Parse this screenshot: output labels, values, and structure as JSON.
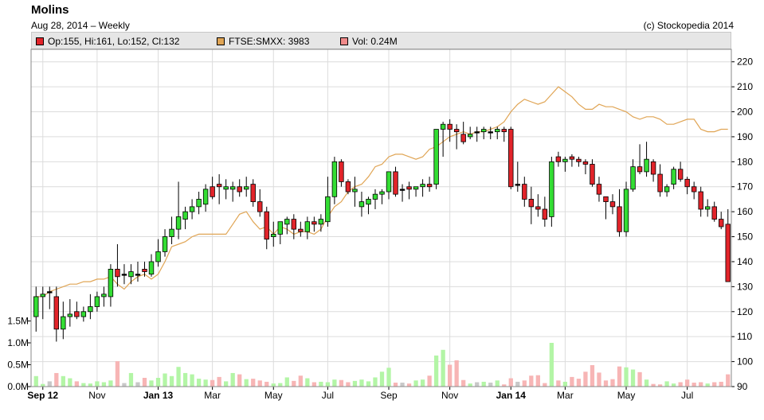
{
  "header": {
    "title": "Molins",
    "subtitle": "Aug 28, 2014  – Weekly",
    "copyright": "(c) Stockopedia 2014"
  },
  "legend": [
    {
      "label": "Op:155, Hi:161, Lo:152, Cl:132",
      "color": "#e2242a"
    },
    {
      "label": "FTSE:SMXX: 3983",
      "color": "#e0a555"
    },
    {
      "label": "Vol: 0.24M",
      "color": "#f08a8a"
    }
  ],
  "chart_data": {
    "type": "candlestick",
    "title": "Molins",
    "y_price_ticks": [
      90,
      100,
      110,
      120,
      130,
      140,
      150,
      160,
      170,
      180,
      190,
      200,
      210,
      220
    ],
    "y_price_range": [
      90,
      225
    ],
    "y_volume_ticks": [
      "0.0M",
      "0.5M",
      "1.0M",
      "1.5M"
    ],
    "y_volume_values": [
      0,
      0.5,
      1.0,
      1.5
    ],
    "x_tick_labels": [
      {
        "label": "Sep 12",
        "bold": true,
        "week": 1
      },
      {
        "label": "Nov",
        "bold": false,
        "week": 9
      },
      {
        "label": "Jan 13",
        "bold": true,
        "week": 18
      },
      {
        "label": "Mar",
        "bold": false,
        "week": 26
      },
      {
        "label": "May",
        "bold": false,
        "week": 35
      },
      {
        "label": "Jul",
        "bold": false,
        "week": 43
      },
      {
        "label": "Sep",
        "bold": false,
        "week": 52
      },
      {
        "label": "Nov",
        "bold": false,
        "week": 61
      },
      {
        "label": "Jan 14",
        "bold": true,
        "week": 70
      },
      {
        "label": "Mar",
        "bold": false,
        "week": 78
      },
      {
        "label": "May",
        "bold": false,
        "week": 87
      },
      {
        "label": "Jul",
        "bold": false,
        "week": 96
      }
    ],
    "candles": [
      [
        118,
        130,
        112,
        126
      ],
      [
        126,
        130,
        117,
        127
      ],
      [
        128,
        130,
        121,
        128
      ],
      [
        126,
        130,
        108,
        113
      ],
      [
        113,
        124,
        109,
        118
      ],
      [
        118,
        125,
        114,
        119
      ],
      [
        120,
        124,
        117,
        118
      ],
      [
        118,
        122,
        116,
        120
      ],
      [
        120,
        127,
        117,
        122
      ],
      [
        122,
        128,
        120,
        126
      ],
      [
        126,
        130,
        122,
        127
      ],
      [
        126,
        139,
        122,
        137
      ],
      [
        137,
        147,
        130,
        134
      ],
      [
        135,
        139,
        131,
        135
      ],
      [
        134,
        139,
        131,
        136
      ],
      [
        135,
        140,
        132,
        135
      ],
      [
        137,
        140,
        134,
        136
      ],
      [
        135,
        143,
        134,
        140
      ],
      [
        140,
        149,
        138,
        144
      ],
      [
        144,
        153,
        142,
        150
      ],
      [
        150,
        158,
        147,
        153
      ],
      [
        153,
        172,
        149,
        158
      ],
      [
        157,
        162,
        153,
        160
      ],
      [
        160,
        165,
        157,
        162
      ],
      [
        162,
        168,
        159,
        165
      ],
      [
        163,
        171,
        160,
        169
      ],
      [
        170,
        174,
        165,
        166
      ],
      [
        171,
        175,
        163,
        170
      ],
      [
        169,
        173,
        165,
        170
      ],
      [
        169,
        172,
        164,
        170
      ],
      [
        170,
        173,
        166,
        168
      ],
      [
        169,
        174,
        166,
        170
      ],
      [
        171,
        173,
        162,
        164
      ],
      [
        164,
        169,
        158,
        160
      ],
      [
        160,
        162,
        145,
        149
      ],
      [
        150,
        156,
        146,
        151
      ],
      [
        151,
        156,
        147,
        156
      ],
      [
        155,
        158,
        151,
        157
      ],
      [
        157,
        159,
        149,
        153
      ],
      [
        153,
        156,
        150,
        152
      ],
      [
        152,
        158,
        149,
        156
      ],
      [
        156,
        158,
        152,
        155
      ],
      [
        155,
        159,
        152,
        157
      ],
      [
        156,
        174,
        154,
        166
      ],
      [
        166,
        182,
        163,
        180
      ],
      [
        180,
        181,
        170,
        172
      ],
      [
        172,
        173,
        167,
        168
      ],
      [
        168,
        174,
        162,
        169
      ],
      [
        162,
        168,
        158,
        164
      ],
      [
        163,
        166,
        159,
        165
      ],
      [
        165,
        169,
        161,
        167
      ],
      [
        167,
        169,
        163,
        168
      ],
      [
        168,
        176,
        165,
        176
      ],
      [
        176,
        178,
        166,
        167
      ],
      [
        169,
        171,
        164,
        169
      ],
      [
        170,
        172,
        165,
        169
      ],
      [
        169,
        170,
        166,
        170
      ],
      [
        170,
        173,
        166,
        171
      ],
      [
        171,
        174,
        168,
        170
      ],
      [
        171,
        193,
        169,
        193
      ],
      [
        193,
        196,
        182,
        195
      ],
      [
        195,
        197,
        188,
        193
      ],
      [
        193,
        195,
        185,
        192
      ],
      [
        191,
        196,
        187,
        188
      ],
      [
        190,
        194,
        189,
        191
      ],
      [
        192,
        194,
        188,
        192
      ],
      [
        192,
        194,
        189,
        193
      ],
      [
        192,
        194,
        189,
        192
      ],
      [
        192,
        194,
        189,
        193
      ],
      [
        193,
        194,
        188,
        192
      ],
      [
        193,
        194,
        169,
        170
      ],
      [
        171,
        180,
        168,
        171
      ],
      [
        171,
        174,
        162,
        165
      ],
      [
        165,
        170,
        155,
        162
      ],
      [
        162,
        167,
        158,
        161
      ],
      [
        161,
        166,
        154,
        157
      ],
      [
        158,
        182,
        154,
        180
      ],
      [
        182,
        184,
        178,
        180
      ],
      [
        180,
        182,
        176,
        181
      ],
      [
        182,
        183,
        178,
        181
      ],
      [
        181,
        182,
        178,
        180
      ],
      [
        180,
        181,
        175,
        179
      ],
      [
        179,
        181,
        170,
        171
      ],
      [
        171,
        174,
        164,
        167
      ],
      [
        166,
        166,
        157,
        164
      ],
      [
        164,
        167,
        159,
        162
      ],
      [
        162,
        169,
        150,
        152
      ],
      [
        152,
        172,
        150,
        169
      ],
      [
        169,
        181,
        168,
        178
      ],
      [
        178,
        187,
        175,
        176
      ],
      [
        176,
        188,
        174,
        181
      ],
      [
        180,
        181,
        172,
        175
      ],
      [
        175,
        179,
        166,
        168
      ],
      [
        168,
        171,
        166,
        170
      ],
      [
        171,
        178,
        169,
        177
      ],
      [
        177,
        180,
        172,
        173
      ],
      [
        173,
        174,
        167,
        170
      ],
      [
        170,
        172,
        165,
        168
      ],
      [
        168,
        170,
        158,
        161
      ],
      [
        161,
        165,
        158,
        162
      ],
      [
        162,
        164,
        156,
        157
      ],
      [
        157,
        160,
        153,
        154
      ],
      [
        155,
        161,
        152,
        132
      ]
    ],
    "volume_millions": [
      0.24,
      0.06,
      0.12,
      0.31,
      0.24,
      0.19,
      0.12,
      0.08,
      0.07,
      0.12,
      0.1,
      0.14,
      0.58,
      0.08,
      0.31,
      0.1,
      0.2,
      0.14,
      0.2,
      0.3,
      0.24,
      0.45,
      0.31,
      0.28,
      0.18,
      0.16,
      0.15,
      0.22,
      0.12,
      0.31,
      0.28,
      0.17,
      0.18,
      0.14,
      0.11,
      0.07,
      0.08,
      0.21,
      0.13,
      0.25,
      0.19,
      0.1,
      0.11,
      0.1,
      0.16,
      0.15,
      0.1,
      0.13,
      0.16,
      0.12,
      0.21,
      0.34,
      0.43,
      0.09,
      0.09,
      0.07,
      0.14,
      0.16,
      0.25,
      0.71,
      0.84,
      0.5,
      0.6,
      0.15,
      0.07,
      0.1,
      0.11,
      0.09,
      0.14,
      0.05,
      0.19,
      0.11,
      0.14,
      0.25,
      0.26,
      0.08,
      1.0,
      0.14,
      0.11,
      0.22,
      0.18,
      0.34,
      0.49,
      0.32,
      0.14,
      0.17,
      0.46,
      0.44,
      0.39,
      0.33,
      0.16,
      0.06,
      0.05,
      0.12,
      0.07,
      0.1,
      0.16,
      0.09,
      0.1,
      0.07,
      0.1,
      0.11,
      0.28
    ],
    "ftse_smxx": [
      126,
      126,
      128,
      129,
      130,
      131,
      131,
      132,
      132,
      133,
      133,
      134,
      131,
      129,
      132,
      134,
      135,
      133,
      135,
      140,
      146,
      147,
      148,
      150,
      151,
      151,
      151,
      151,
      151,
      155,
      159,
      160,
      156,
      153,
      154,
      151,
      154,
      153,
      151,
      152,
      152,
      151,
      153,
      158,
      162,
      164,
      168,
      170,
      171,
      174,
      178,
      179,
      182,
      183,
      183,
      182,
      181,
      182,
      185,
      186,
      188,
      190,
      191,
      192,
      191,
      192,
      192,
      193,
      194,
      196,
      200,
      203,
      205,
      204,
      203,
      204,
      207,
      210,
      208,
      206,
      203,
      201,
      201,
      203,
      202,
      202,
      201,
      200,
      198,
      197,
      198,
      198,
      197,
      195,
      195,
      196,
      197,
      197,
      193,
      192,
      192,
      193,
      193
    ],
    "colors": {
      "up": "#33dd33",
      "down": "#e2242a",
      "vol_up": "#b3f5a6",
      "vol_down": "#f7b5b5",
      "vol_flat": "#c8c8c8",
      "ftse": "#e0a555",
      "grid": "#dcdcdc"
    }
  }
}
